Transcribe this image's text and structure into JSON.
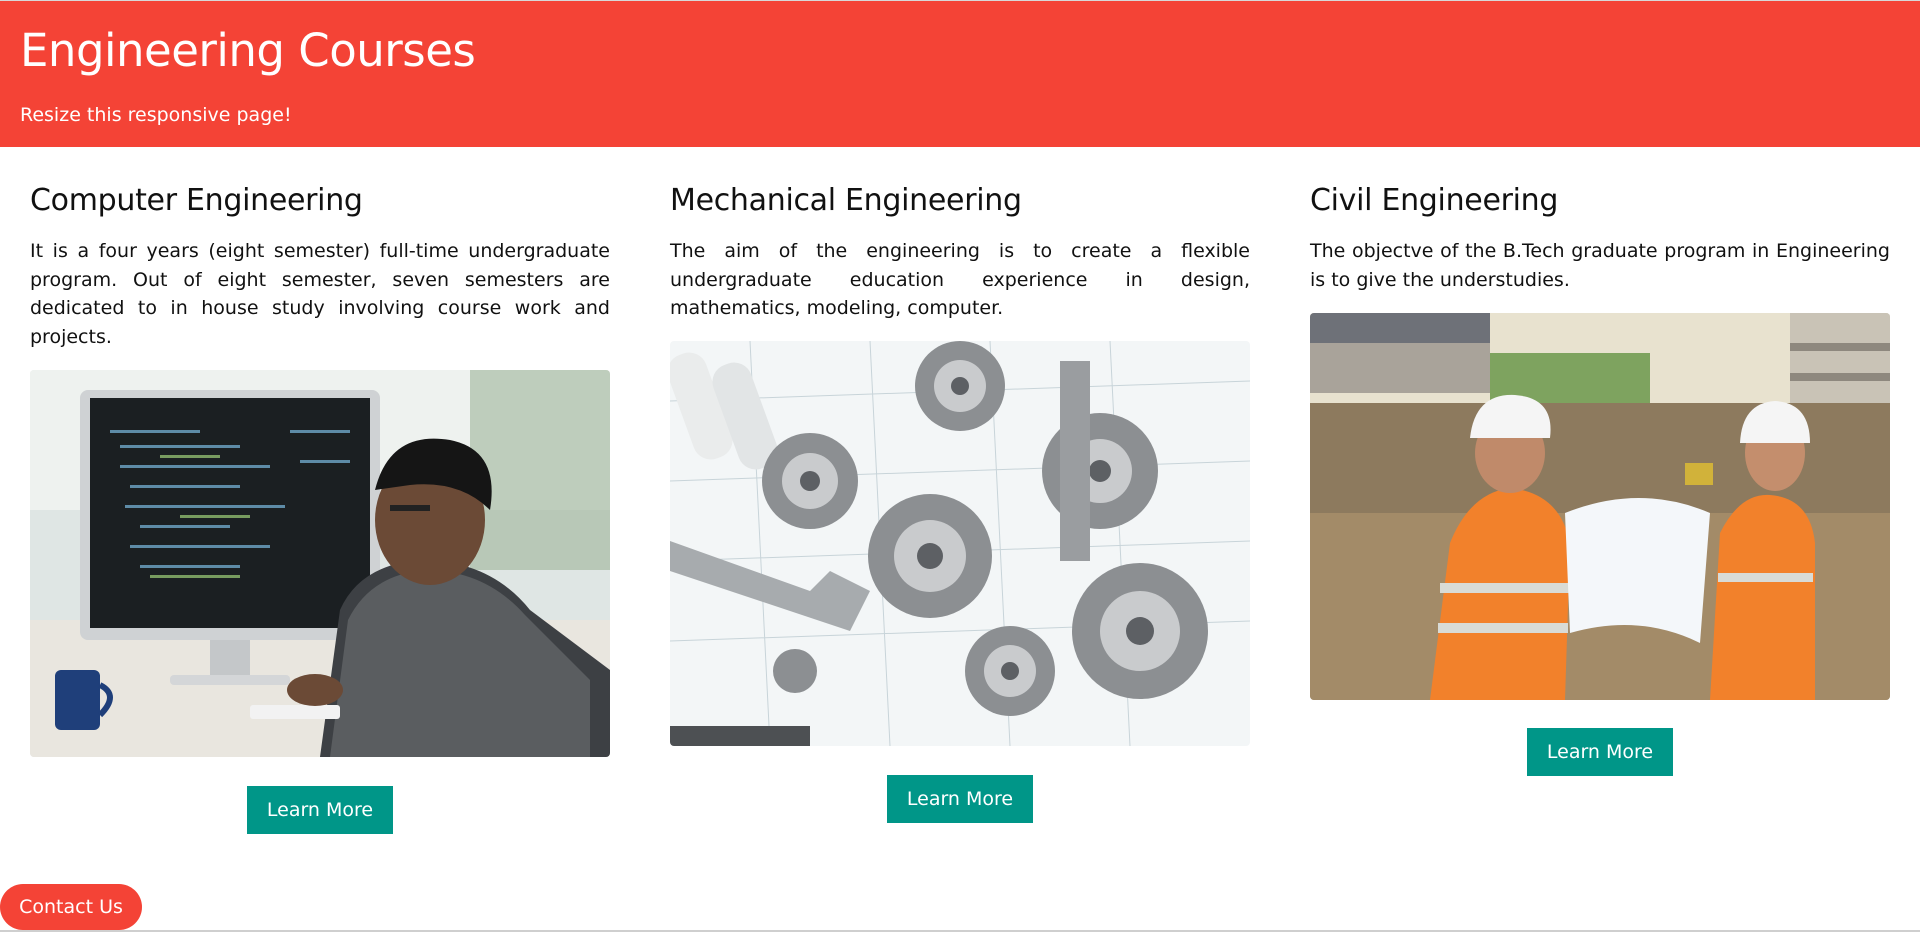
{
  "header": {
    "title": "Engineering Courses",
    "subtitle": "Resize this responsive page!"
  },
  "courses": [
    {
      "title": "Computer Engineering",
      "description": "It is a four years (eight semester) full-time undergraduate program. Out of eight semester, seven semesters are dedicated to in house study involving course work and projects.",
      "image": "programmer-at-monitor-photo",
      "button": "Learn More"
    },
    {
      "title": "Mechanical Engineering",
      "description": "The aim of the engineering is to create a flexible undergraduate education experience in design, mathematics, modeling, computer.",
      "image": "gears-and-blueprints-photo",
      "button": "Learn More"
    },
    {
      "title": "Civil Engineering",
      "description": "The objectve of the B.Tech graduate program in Engineering is to give the understudies.",
      "image": "construction-engineers-photo",
      "button": "Learn More"
    }
  ],
  "contact": {
    "label": "Contact Us"
  },
  "colors": {
    "header_bg": "#f44336",
    "button_bg": "#009688",
    "contact_bg": "#f44336"
  }
}
